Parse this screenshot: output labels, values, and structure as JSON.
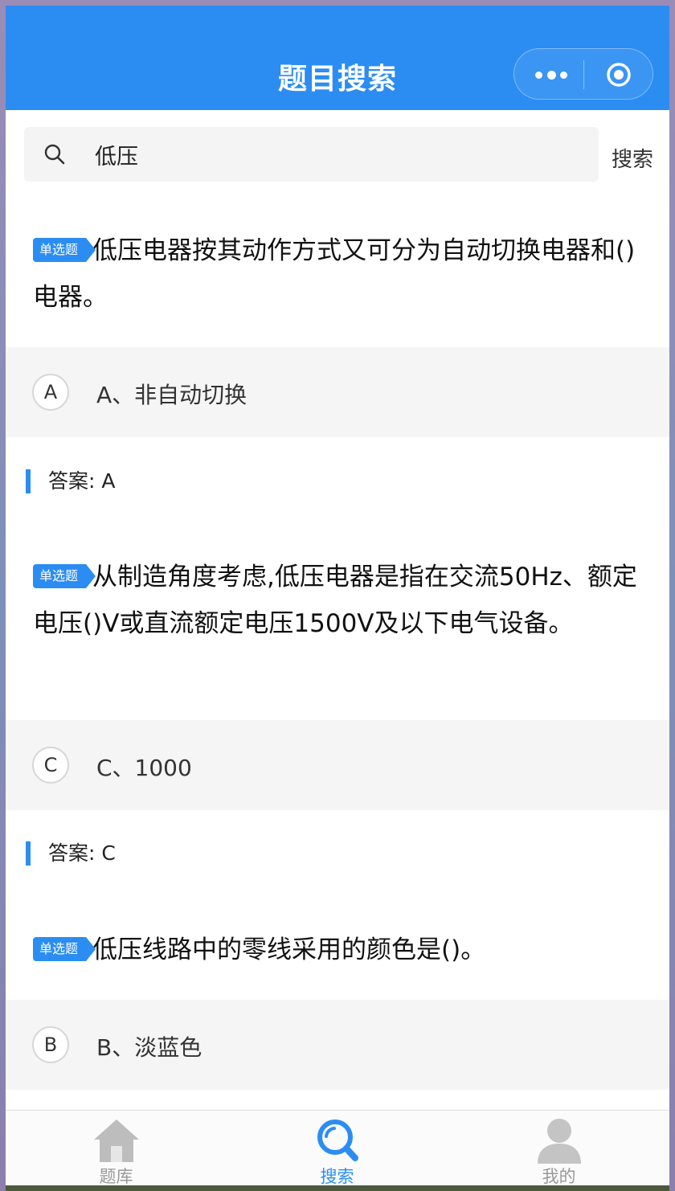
{
  "navbar": {
    "title": "题目搜索"
  },
  "search": {
    "value": "低压",
    "button_label": "搜索"
  },
  "questions": [
    {
      "type_badge": "单选题",
      "text": "低压电器按其动作方式又可分为自动切换电器和()电器。",
      "option_letter": "A",
      "option_text": "A、非自动切换",
      "answer": "答案: A"
    },
    {
      "type_badge": "单选题",
      "text": "从制造角度考虑,低压电器是指在交流50Hz、额定电压()V或直流额定电压1500V及以下电气设备。",
      "option_letter": "C",
      "option_text": "C、1000",
      "answer": "答案: C"
    },
    {
      "type_badge": "单选题",
      "text": "低压线路中的零线采用的颜色是()。",
      "option_letter": "B",
      "option_text": "B、淡蓝色"
    }
  ],
  "tabbar": {
    "items": [
      {
        "label": "题库",
        "icon": "home-icon",
        "active": false
      },
      {
        "label": "搜索",
        "icon": "search-icon",
        "active": true
      },
      {
        "label": "我的",
        "icon": "user-icon",
        "active": false
      }
    ]
  },
  "colors": {
    "primary": "#2b8df2",
    "option_bg": "#f5f5f5",
    "tab_inactive": "#999999"
  }
}
